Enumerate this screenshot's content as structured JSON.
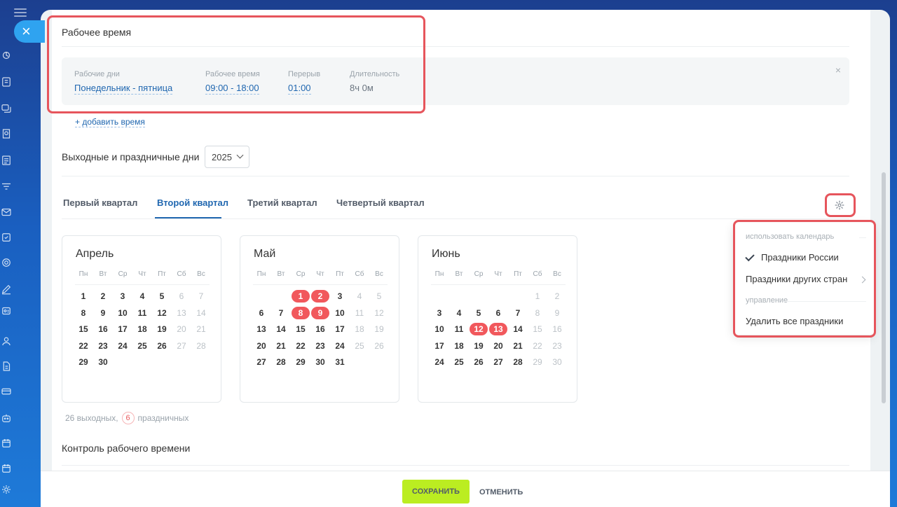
{
  "work_time": {
    "title": "Рабочее время",
    "days_label": "Рабочие дни",
    "days_value": "Понедельник - пятница",
    "hours_label": "Рабочее время",
    "hours_value": "09:00 - 18:00",
    "break_label": "Перерыв",
    "break_value": "01:00",
    "duration_label": "Длительность",
    "duration_value": "8ч 0м",
    "close_glyph": "×",
    "add_link": "+ добавить время"
  },
  "holidays": {
    "label": "Выходные и праздничные дни",
    "year": "2025"
  },
  "tabs": [
    {
      "label": "Первый квартал"
    },
    {
      "label": "Второй квартал",
      "active": true
    },
    {
      "label": "Третий квартал"
    },
    {
      "label": "Четвертый квартал"
    }
  ],
  "weekdays": [
    "Пн",
    "Вт",
    "Ср",
    "Чт",
    "Пт",
    "Сб",
    "Вс"
  ],
  "months": [
    {
      "name": "Апрель",
      "first_weekday": 1,
      "days": 30,
      "holidays": []
    },
    {
      "name": "Май",
      "first_weekday": 3,
      "days": 31,
      "holidays": [
        1,
        2,
        8,
        9
      ]
    },
    {
      "name": "Июнь",
      "first_weekday": 6,
      "days": 30,
      "holidays": [
        12,
        13
      ]
    }
  ],
  "summary": {
    "weekends_text": "26 выходных,",
    "holidays_count": "6",
    "holidays_text": "праздничных"
  },
  "control_title": "Контроль рабочего времени",
  "footer": {
    "save_label": "СОХРАНИТЬ",
    "cancel_label": "ОТМЕНИТЬ"
  },
  "menu": {
    "header_calendar": "использовать календарь",
    "item_russia": "Праздники России",
    "item_other": "Праздники других стран",
    "header_manage": "управление",
    "item_delete": "Удалить все праздники"
  },
  "colors": {
    "accent_blue": "#2067b0",
    "holiday_red": "#f1585c",
    "save_green": "#bbed21",
    "highlight_red": "#e6555c"
  },
  "rail_icons": [
    "menu-icon",
    "close-icon",
    "feed-icon",
    "tasks-icon",
    "chat-icon",
    "crm-icon",
    "docs-icon",
    "filter-icon",
    "mail-icon",
    "checkbox-icon",
    "target-icon",
    "sign-icon",
    "profile-card-icon",
    "users-icon",
    "doc-icon",
    "card-icon",
    "bot-icon",
    "calendar-icon",
    "calendar2-icon",
    "settings-icon"
  ]
}
